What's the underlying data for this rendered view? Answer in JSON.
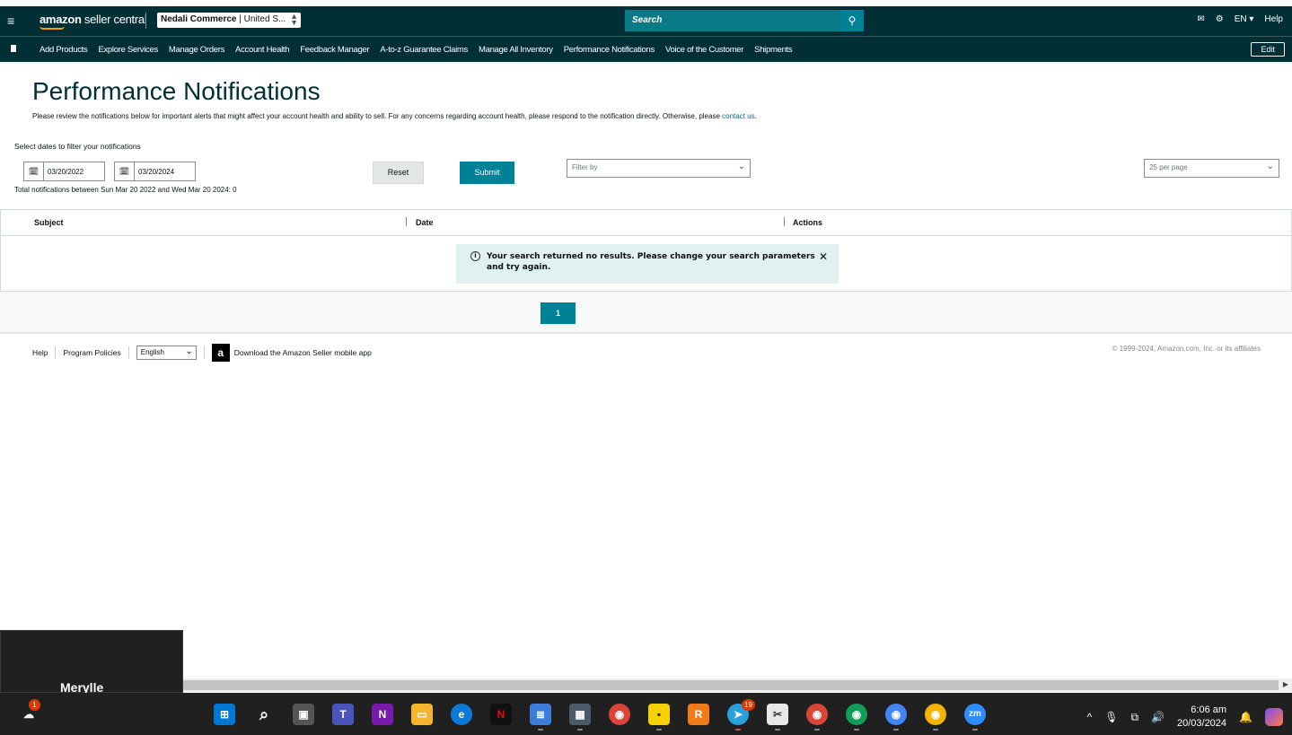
{
  "header": {
    "logo_bold": "amazon",
    "logo_rest": " seller central",
    "account_bold": "Nedali Commerce",
    "account_rest": " | United S...",
    "search_placeholder": "Search",
    "language": "EN",
    "help": "Help"
  },
  "nav": {
    "items": [
      "Add Products",
      "Explore Services",
      "Manage Orders",
      "Account Health",
      "Feedback Manager",
      "A-to-z Guarantee Claims",
      "Manage All Inventory",
      "Performance Notifications",
      "Voice of the Customer",
      "Shipments"
    ],
    "edit": "Edit"
  },
  "page": {
    "title": "Performance Notifications",
    "intro": "Please review the notifications below for important alerts that might affect your account health and ability to sell. For any concerns regarding account health, please respond to the notification directly. Otherwise, please ",
    "contact_link": "contact us",
    "intro_end": ".",
    "date_label": "Select dates to filter your notifications",
    "start_date": "03/20/2022",
    "end_date": "03/20/2024",
    "total": "Total notifications between Sun Mar 20 2022 and Wed Mar 20 2024: 0",
    "reset": "Reset",
    "submit": "Submit",
    "filter_placeholder": "Filter by",
    "per_page": "25 per page"
  },
  "table": {
    "columns": [
      "Subject",
      "Date",
      "Actions"
    ],
    "alert": "Your search returned no results. Please change your search parameters and try again."
  },
  "pagination": {
    "current": "1"
  },
  "footer": {
    "help": "Help",
    "policies": "Program Policies",
    "language": "English",
    "app": "Download the Amazon Seller mobile app",
    "copyright": "© 1999-2024, Amazon.com, Inc. or its affiliates"
  },
  "tooltip": {
    "name": "Merylle"
  },
  "taskbar": {
    "weather_badge": "1",
    "telegram_badge": "19",
    "time": "6:06 am",
    "date": "20/03/2024"
  }
}
